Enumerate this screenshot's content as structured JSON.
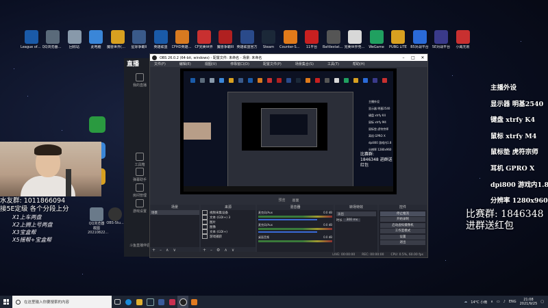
{
  "desktop_icons": [
    {
      "label": "League of Legends",
      "color": "#1a5aa8"
    },
    {
      "label": "QQ浏览器截图20210822...",
      "color": "#5a6a7a"
    },
    {
      "label": "回收站",
      "color": "#8899aa"
    },
    {
      "label": "此电脑",
      "color": "#3a86d8"
    },
    {
      "label": "魔兽世界(精美怀旧服)",
      "color": "#d8a020"
    },
    {
      "label": "星际争霸II",
      "color": "#3a5a8a"
    },
    {
      "label": "英雄联盟",
      "color": "#1a5aa8"
    },
    {
      "label": "CFHD英雄战场",
      "color": "#d87a20"
    },
    {
      "label": "CF完美世界",
      "color": "#c83030"
    },
    {
      "label": "魔兽争霸III",
      "color": "#b02020"
    },
    {
      "label": "英雄联盟官方",
      "color": "#2a4a8a"
    },
    {
      "label": "Steam",
      "color": "#1b2838"
    },
    {
      "label": "Counter-Strike Global...",
      "color": "#e07a1a"
    },
    {
      "label": "11平台",
      "color": "#c82020"
    },
    {
      "label": "Battlestate Games...",
      "color": "#555555"
    },
    {
      "label": "完美世界竞技平台",
      "color": "#d8d8d8"
    },
    {
      "label": "WeGame",
      "color": "#20a060"
    },
    {
      "label": "PUBG LITE",
      "color": "#d8a020"
    },
    {
      "label": "B5对战平台",
      "color": "#2a6ad8"
    },
    {
      "label": "5E对战平台",
      "color": "#3a3a8a"
    },
    {
      "label": "小威无限",
      "color": "#c83030"
    }
  ],
  "side_icons": [
    {
      "label": "微信",
      "color": "#2a9a40"
    },
    {
      "label": "2017121...",
      "color": "#3a86d8"
    }
  ],
  "qq_icons": [
    {
      "label": "QQ浏览器截图20210822...",
      "color": "#6a7a8a"
    },
    {
      "label": "OBS-Stu...",
      "color": "#333"
    },
    {
      "label": "新建文件夹",
      "color": "#d8a020"
    }
  ],
  "overlay_left": {
    "line1": "水友群: 1011866094",
    "line2": "接5E定级 各个分段上分",
    "line3": "X1上车两盘",
    "line4": "X2上拥上号两盘",
    "line5": "X3宝盒帮",
    "line6": "X5摇帮+宝盒帮"
  },
  "overlay_right": {
    "title": "主播外设",
    "monitor": "显示器 明基2540",
    "keyboard": "键盘 xtrfy K4",
    "mouse": "鼠标 xtrfy M4",
    "mousepad": "鼠标垫 虎符宗师",
    "headset": "耳机 GPRO X",
    "dpi": "dpi800 游戏内1.8",
    "resolution": "分辨率 1280x960",
    "match_group": "比赛群: 1846348",
    "red_packet": "进群送红包"
  },
  "streamer_app": {
    "logo": "直播",
    "items": [
      "我的直播",
      "工具箱",
      "弹幕助手",
      "房间管理",
      "游戏设置"
    ],
    "bottom": "斗鱼直播伴侣"
  },
  "obs": {
    "title": "OBS 26.0.2 (64-bit, windows) - 配置文件: 未命名 - 场景: 未命名",
    "menu": [
      "文件(F)",
      "编辑(E)",
      "视图(V)",
      "停靠窗口(D)",
      "配置文件(P)",
      "场景集合(S)",
      "工具(T)",
      "帮助(H)"
    ],
    "nested_right": [
      "主播外设",
      "显示器 明基2540",
      "键盘 xtrfy K4",
      "鼠标 xtrfy M4",
      "鼠标垫 虎符宗师",
      "耳机 GPRO X",
      "dpi800 游戏内1.8",
      "分辨率 1280x960"
    ],
    "nested_big": "比赛群: 1846348 进群送红包",
    "ctrl_bar": [
      "预览",
      "画面"
    ],
    "docks": {
      "scenes": {
        "header": "场景",
        "items": [
          "场景"
        ]
      },
      "sources": {
        "header": "来源",
        "items": [
          "视频采集设备",
          "文本 (GDI+) 3",
          "图片",
          "图像",
          "文本 (GDI+)",
          "游戏捕获"
        ]
      },
      "mixer": {
        "header": "混音器",
        "channels": [
          {
            "name": "麦克风/Aux",
            "db": "0.0 dB"
          },
          {
            "name": "麦克风/Aux",
            "db": "0.0 dB"
          },
          {
            "name": "桌面音频",
            "db": "0.0 dB"
          }
        ]
      },
      "transitions": {
        "header": "转场特效",
        "type": "淡出",
        "duration_label": "时长",
        "duration": "300 ms"
      },
      "controls": {
        "header": "控件",
        "buttons": [
          "停止推流",
          "开始录制",
          "启动虚拟摄像机",
          "工作室模式",
          "设置",
          "退出"
        ]
      }
    },
    "status": [
      "LIVE: 00:00:00",
      "REC: 00:00:00",
      "CPU: 0.5%, 60.00 fps"
    ]
  },
  "taskbar": {
    "search_placeholder": "在这里输入你要搜索的内容",
    "weather": "14°C 小雨",
    "lang": "ENG",
    "time": "21:08",
    "date": "2021/9/25"
  }
}
